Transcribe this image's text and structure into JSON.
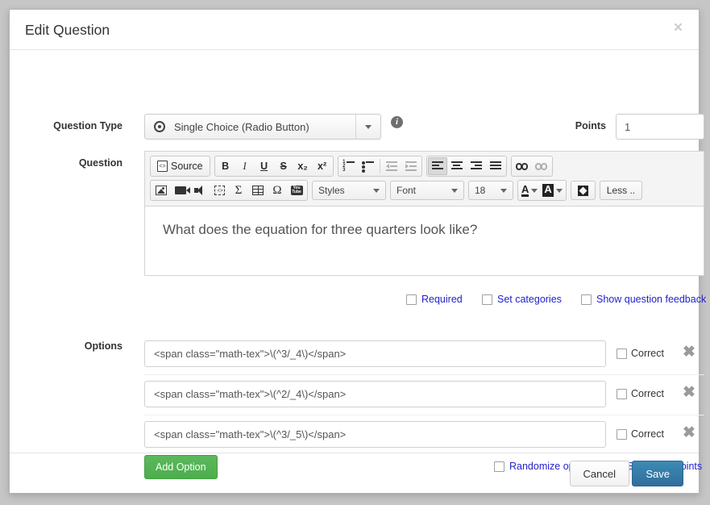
{
  "modal": {
    "title": "Edit Question",
    "close_icon": "close-icon"
  },
  "question_type": {
    "label": "Question Type",
    "value": "Single Choice (Radio Button)",
    "radio_icon": "radio-button-icon",
    "caret_icon": "chevron-down-icon",
    "info_icon": "info-icon",
    "info_glyph": "i"
  },
  "points": {
    "label": "Points",
    "value": "1"
  },
  "question": {
    "label": "Question",
    "body_text": "What does the equation for three quarters look like?",
    "toolbar": {
      "source_label": "Source",
      "bold": "B",
      "italic": "I",
      "underline": "U",
      "strike": "S",
      "subscript": "x₂",
      "superscript": "x²",
      "styles_label": "Styles",
      "font_label": "Font",
      "size_label": "18",
      "less_label": "Less ..",
      "icons": [
        "numbered-list-icon",
        "bulleted-list-icon",
        "decrease-indent-icon",
        "increase-indent-icon",
        "align-left-icon",
        "align-center-icon",
        "align-right-icon",
        "align-justify-icon",
        "link-icon",
        "unlink-icon",
        "image-icon",
        "video-icon",
        "audio-icon",
        "code-snippet-icon",
        "math-sigma-icon",
        "table-icon",
        "special-char-omega-icon",
        "youtube-icon",
        "text-color-icon",
        "background-color-icon",
        "maximize-icon"
      ],
      "sigma_glyph": "Σ",
      "omega_glyph": "Ω",
      "youtube_glyph": "You Tube"
    },
    "checkboxes": [
      {
        "label": "Required",
        "checked": false
      },
      {
        "label": "Set categories",
        "checked": false
      },
      {
        "label": "Show question feedback",
        "checked": false
      }
    ]
  },
  "options": {
    "label": "Options",
    "correct_label": "Correct",
    "delete_icon": "delete-option-icon",
    "delete_glyph": "✖",
    "items": [
      {
        "value": "<span class=\"math-tex\">\\(^3/_4\\)</span>",
        "correct": false
      },
      {
        "value": "<span class=\"math-tex\">\\(^2/_4\\)</span>",
        "correct": false
      },
      {
        "value": "<span class=\"math-tex\">\\(^3/_5\\)</span>",
        "correct": false
      }
    ],
    "add_option_label": "Add Option",
    "bottom_checkboxes": [
      {
        "label": "Randomize options",
        "checked": false
      },
      {
        "label": "Set option points",
        "checked": false
      }
    ]
  },
  "footer": {
    "cancel_label": "Cancel",
    "save_label": "Save"
  },
  "colors": {
    "backdrop": "#c6c6c6",
    "link_blue": "#2222cc",
    "primary_button": "#336f9e",
    "success_button": "#53a653"
  }
}
